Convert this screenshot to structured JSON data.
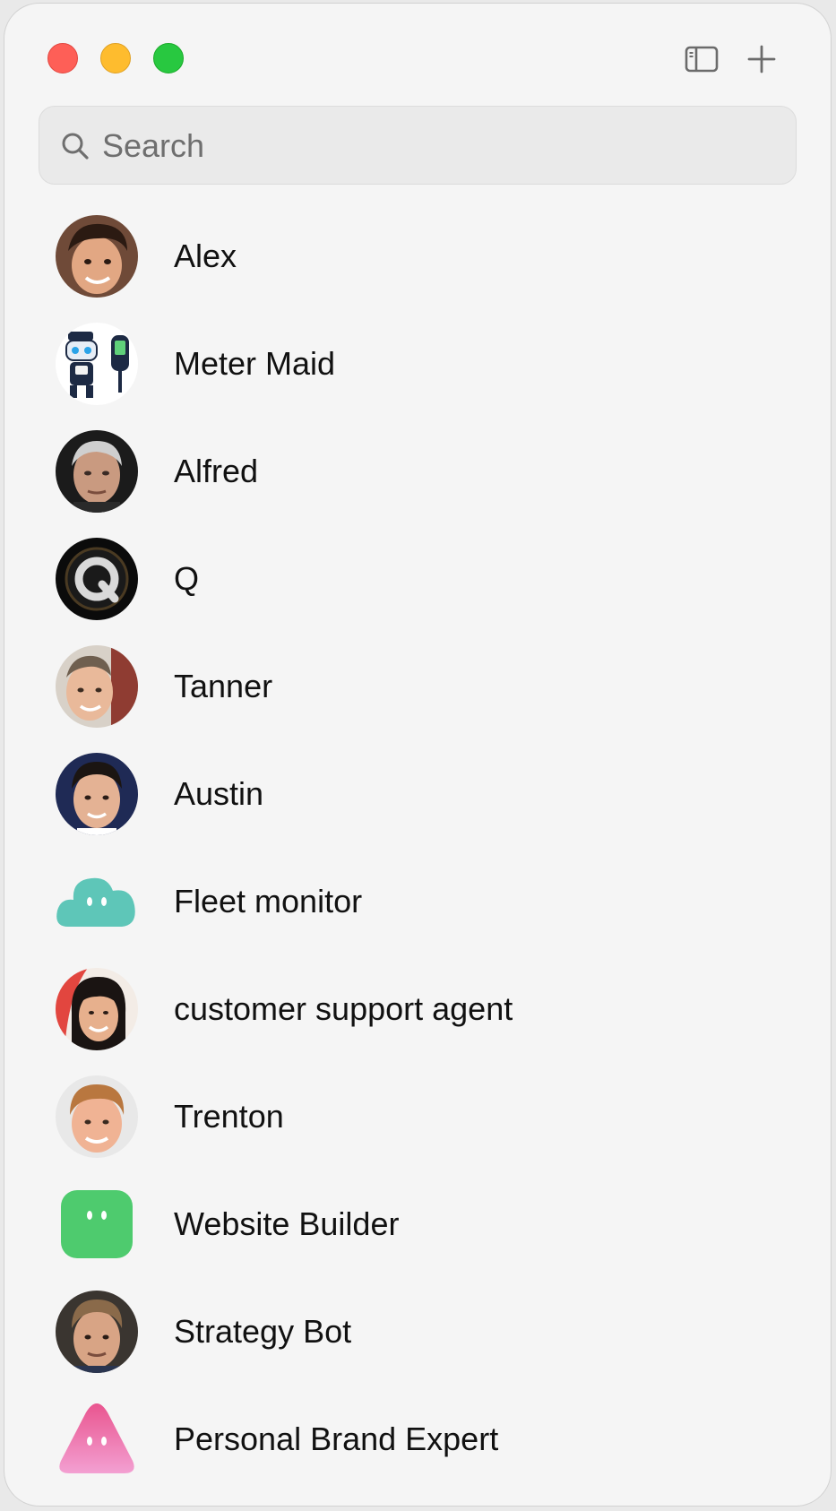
{
  "window": {
    "controls": [
      "close",
      "minimize",
      "maximize"
    ],
    "toolbar": {
      "sidebar_icon": "sidebar-toggle-icon",
      "add_icon": "plus-icon"
    }
  },
  "search": {
    "placeholder": "Search",
    "value": "",
    "icon": "search-icon"
  },
  "contacts": [
    {
      "name": "Alex",
      "avatar": "photo"
    },
    {
      "name": "Meter Maid",
      "avatar": "robot-illustration"
    },
    {
      "name": "Alfred",
      "avatar": "photo"
    },
    {
      "name": "Q",
      "avatar": "q-logo"
    },
    {
      "name": "Tanner",
      "avatar": "photo"
    },
    {
      "name": "Austin",
      "avatar": "photo"
    },
    {
      "name": "Fleet monitor",
      "avatar": "teal-cloud",
      "color": "#5ec6b8"
    },
    {
      "name": "customer support agent",
      "avatar": "photo"
    },
    {
      "name": "Trenton",
      "avatar": "photo"
    },
    {
      "name": "Website Builder",
      "avatar": "green-square",
      "color": "#4ecb6e"
    },
    {
      "name": "Strategy Bot",
      "avatar": "photo"
    },
    {
      "name": "Personal Brand Expert",
      "avatar": "pink-triangle",
      "color": "#ee6fb4"
    }
  ]
}
